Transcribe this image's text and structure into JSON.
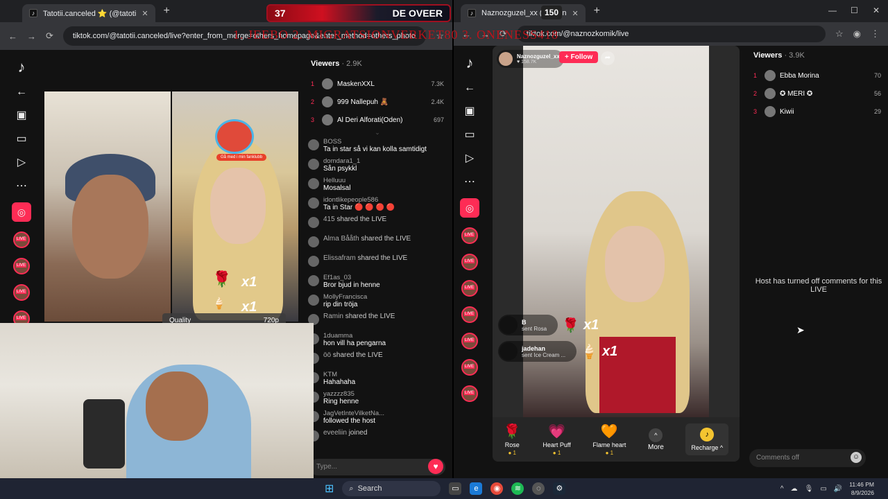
{
  "overlay": {
    "counter_left": "37",
    "title": "DE OVEER",
    "counter_right": "150",
    "marquee": "1. JEEBO 2. MIGRATSIONVERKET80 3. ONENESS418"
  },
  "left_window": {
    "tab_title": "Tatotii.canceled ⭐ (@tatoti",
    "url": "tiktok.com/@tatotii.canceled/live?enter_from_merge=others_homepage&enter_method=others_photo",
    "quality_label": "Quality",
    "quality_value": "720p",
    "gift_rose_label": "x1",
    "gift_icecream_label": "x1",
    "sticker_text": "Gå med i min fanklubb",
    "viewers_title": "Viewers",
    "viewers_count": "· 2.9K",
    "viewers": [
      {
        "rank": "1",
        "name": "MaskenXXL",
        "count": "7.3K"
      },
      {
        "rank": "2",
        "name": "999 Nallepuh 🧸",
        "count": "2.4K"
      },
      {
        "rank": "3",
        "name": "Al Deri Alforati(Oden)",
        "count": "697"
      }
    ],
    "chat": [
      {
        "name": "BOSS",
        "text": "Ta in star så vi kan kolla samtidigt"
      },
      {
        "name": "domdara1_1",
        "text": "Sån psykkl"
      },
      {
        "name": "Helluuu",
        "text": "Mosalsal"
      },
      {
        "name": "idontlikepeople586",
        "text": "Ta in Star 🔴 🔴 🔴 🔴"
      },
      {
        "name": "415",
        "text": "shared the LIVE",
        "system": true
      },
      {
        "name": "Alma Bååth",
        "text": "shared the LIVE",
        "system": true
      },
      {
        "name": "Elissafram",
        "text": "shared the LIVE",
        "system": true
      },
      {
        "name": "Ef1as_03",
        "text": "Bror bjud in henne"
      },
      {
        "name": "MollyFrancisca",
        "text": "rip din tröja"
      },
      {
        "name": "Ramin",
        "text": "shared the LIVE",
        "system": true
      },
      {
        "name": "1duamma",
        "text": "hon vill ha pengarna"
      },
      {
        "name": "öö",
        "text": "shared the LIVE",
        "system": true
      },
      {
        "name": "KTM",
        "text": "Hahahaha"
      },
      {
        "name": "yazzzz835",
        "text": "Ring henne"
      },
      {
        "name": "JagVetInteVilketNa...",
        "text": "followed the host"
      },
      {
        "name": "eveeliin",
        "text": "joined",
        "system": true
      }
    ],
    "input_placeholder": "Type..."
  },
  "right_window": {
    "tab_title": "Naznozguzel_xx (@nazn",
    "url": "tiktok.com/@naznozkomik/live",
    "host_name": "Naznozguzel_xx",
    "host_likes": "♥ 158.7K",
    "follow_label": "+ Follow",
    "gifts_feed": [
      {
        "name": "B",
        "sub": "sent Rosa",
        "icon": "🌹",
        "count": "x1"
      },
      {
        "name": "jadehan",
        "sub": "sent Ice Cream ...",
        "icon": "🍦",
        "count": "x1"
      }
    ],
    "gift_bar": [
      {
        "icon": "🌹",
        "label": "Rose",
        "cost": "1"
      },
      {
        "icon": "💗",
        "label": "Heart Puff",
        "cost": "1"
      },
      {
        "icon": "🧡",
        "label": "Flame heart",
        "cost": "1"
      }
    ],
    "more_label": "More",
    "recharge_label": "Recharge ^",
    "viewers_title": "Viewers",
    "viewers_count": "· 3.9K",
    "viewers": [
      {
        "rank": "1",
        "name": "Ebba Morina",
        "count": "70"
      },
      {
        "rank": "2",
        "name": "✪ MERI ✪",
        "count": "56"
      },
      {
        "rank": "3",
        "name": "Kiwii",
        "count": "29"
      }
    ],
    "comments_off_msg": "Host has turned off comments for this LIVE",
    "comments_placeholder": "Comments off"
  },
  "taskbar": {
    "search": "Search",
    "time": "11:46 PM",
    "date": "8/9/2026"
  },
  "colors": {
    "accent": "#fe2c55",
    "coin": "#f4c430"
  }
}
